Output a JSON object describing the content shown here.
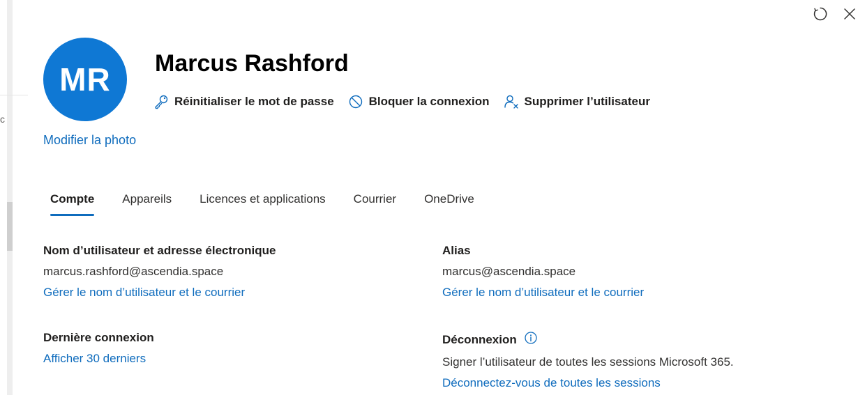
{
  "user": {
    "initials": "MR",
    "name": "Marcus Rashford",
    "modify_photo": "Modifier la photo"
  },
  "actions": {
    "reset_password": "Réinitialiser le mot de passe",
    "block_signin": "Bloquer la connexion",
    "delete_user": "Supprimer l’utilisateur"
  },
  "tabs": [
    {
      "label": "Compte"
    },
    {
      "label": "Appareils"
    },
    {
      "label": "Licences et applications"
    },
    {
      "label": "Courrier"
    },
    {
      "label": "OneDrive"
    }
  ],
  "account": {
    "username_label": "Nom d’utilisateur et adresse électronique",
    "username_value": "marcus.rashford@ascendia.space",
    "username_link": "Gérer le nom d’utilisateur et le courrier",
    "alias_label": "Alias",
    "alias_value": "marcus@ascendia.space",
    "alias_link": "Gérer le nom d’utilisateur et le courrier",
    "last_signin_label": "Dernière connexion",
    "last_signin_link": "Afficher 30 derniers",
    "signout_label": "Déconnexion",
    "signout_value": "Signer l’utilisateur de toutes les sessions Microsoft 365.",
    "signout_link": "Déconnectez-vous de toutes les sessions"
  },
  "backdrop": {
    "edge_char": "c"
  },
  "icons": {
    "refresh": "refresh-icon",
    "close": "close-icon",
    "key": "key-icon",
    "block": "block-icon",
    "delete_user": "delete-user-icon",
    "info": "info-icon"
  },
  "colors": {
    "accent": "#0f6cbd",
    "avatar": "#0f78d4"
  }
}
